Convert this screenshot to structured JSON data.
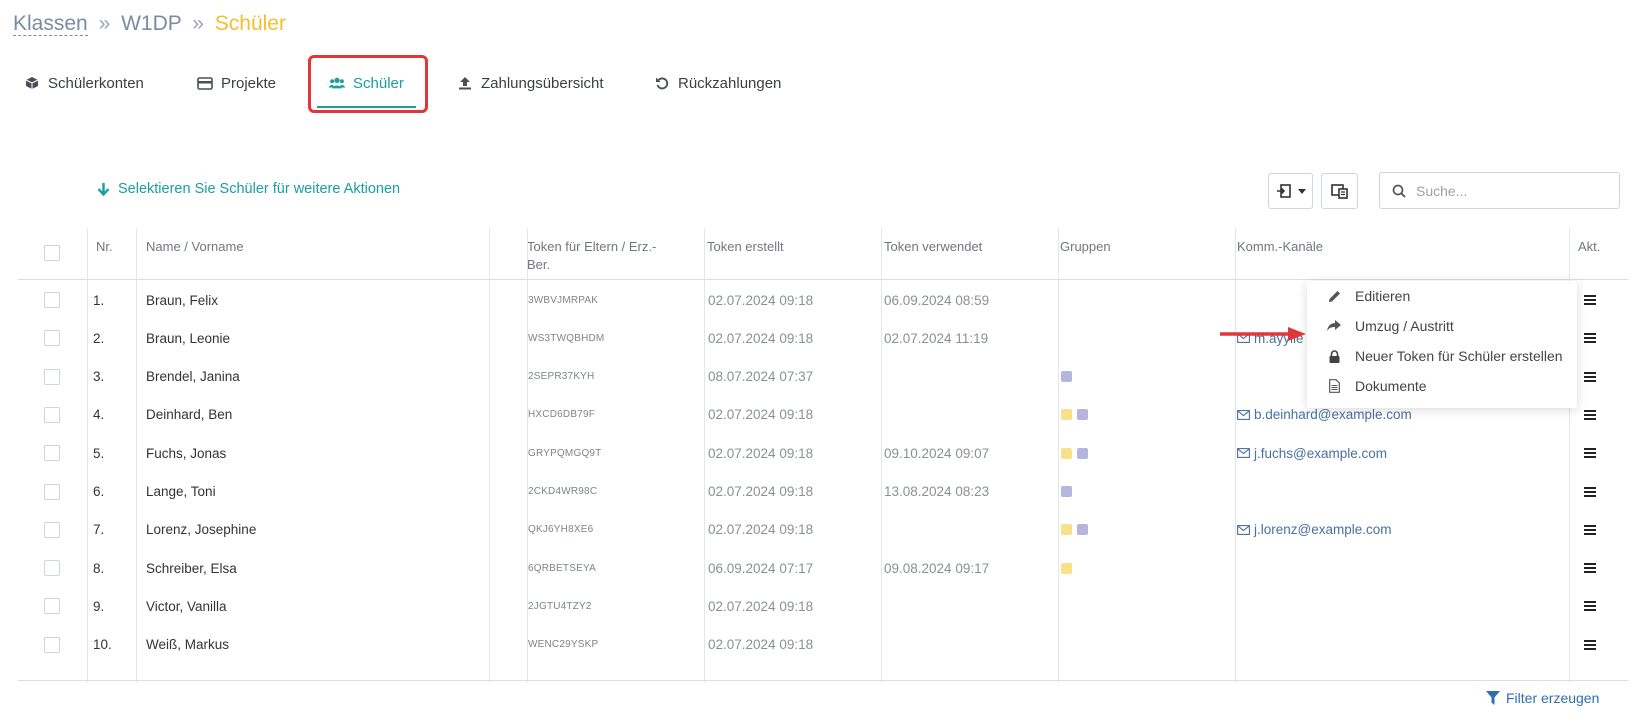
{
  "breadcrumb": {
    "root": "Klassen",
    "sep1": "»",
    "mid": "W1DP",
    "sep2": "»",
    "current": "Schüler"
  },
  "tabs": [
    {
      "label": "Schülerkonten",
      "icon": "cube-icon"
    },
    {
      "label": "Projekte",
      "icon": "card-icon"
    },
    {
      "label": "Schüler",
      "icon": "users-icon",
      "active": true
    },
    {
      "label": "Zahlungsübersicht",
      "icon": "upload-icon"
    },
    {
      "label": "Rückzahlungen",
      "icon": "undo-icon"
    }
  ],
  "select_hint": "Selektieren Sie Schüler für weitere Aktionen",
  "search": {
    "placeholder": "Suche..."
  },
  "table": {
    "headers": {
      "nr": "Nr.",
      "name": "Name / Vorname",
      "token": "Token für Eltern / Erz.-",
      "token2": "Ber.",
      "created": "Token erstellt",
      "used": "Token verwendet",
      "groups": "Gruppen",
      "channels": "Komm.-Kanäle",
      "actions": "Akt."
    },
    "rows": [
      {
        "nr": "1.",
        "name": "Braun, Felix",
        "token": "3WBVJMRPAK",
        "created": "02.07.2024 09:18",
        "used": "06.09.2024 08:59",
        "groups": [],
        "email": ""
      },
      {
        "nr": "2.",
        "name": "Braun, Leonie",
        "token": "WS3TWQBHDM",
        "created": "02.07.2024 09:18",
        "used": "02.07.2024 11:19",
        "groups": [],
        "email": "m.ayylle"
      },
      {
        "nr": "3.",
        "name": "Brendel, Janina",
        "token": "2SEPR37KYH",
        "created": "08.07.2024 07:37",
        "used": "",
        "groups": [
          "#b5b5e0"
        ],
        "email": ""
      },
      {
        "nr": "4.",
        "name": "Deinhard, Ben",
        "token": "HXCD6DB79F",
        "created": "02.07.2024 09:18",
        "used": "",
        "groups": [
          "#f9e08a",
          "#b5b5e0"
        ],
        "email": "b.deinhard@example.com"
      },
      {
        "nr": "5.",
        "name": "Fuchs, Jonas",
        "token": "GRYPQMGQ9T",
        "created": "02.07.2024 09:18",
        "used": "09.10.2024 09:07",
        "groups": [
          "#f9e08a",
          "#b5b5e0"
        ],
        "email": "j.fuchs@example.com"
      },
      {
        "nr": "6.",
        "name": "Lange, Toni",
        "token": "2CKD4WR98C",
        "created": "02.07.2024 09:18",
        "used": "13.08.2024 08:23",
        "groups": [
          "#b5b5e0"
        ],
        "email": ""
      },
      {
        "nr": "7.",
        "name": "Lorenz, Josephine",
        "token": "QKJ6YH8XE6",
        "created": "02.07.2024 09:18",
        "used": "",
        "groups": [
          "#f9e08a",
          "#b5b5e0"
        ],
        "email": "j.lorenz@example.com"
      },
      {
        "nr": "8.",
        "name": "Schreiber, Elsa",
        "token": "6QRBETSEYA",
        "created": "06.09.2024 07:17",
        "used": "09.08.2024 09:17",
        "groups": [
          "#f9e08a"
        ],
        "email": ""
      },
      {
        "nr": "9.",
        "name": "Victor, Vanilla",
        "token": "2JGTU4TZY2",
        "created": "02.07.2024 09:18",
        "used": "",
        "groups": [],
        "email": ""
      },
      {
        "nr": "10.",
        "name": "Weiß, Markus",
        "token": "WENC29YSKP",
        "created": "02.07.2024 09:18",
        "used": "",
        "groups": [],
        "email": ""
      }
    ]
  },
  "dropdown": {
    "items": [
      {
        "label": "Editieren",
        "icon": "pencil-icon"
      },
      {
        "label": "Umzug / Austritt",
        "icon": "share-arrow-icon"
      },
      {
        "label": "Neuer Token für Schüler erstellen",
        "icon": "lock-icon"
      },
      {
        "label": "Dokumente",
        "icon": "document-icon"
      }
    ]
  },
  "footer": {
    "filter_label": "Filter erzeugen"
  },
  "colors": {
    "accent": "#1a9e9e",
    "highlight": "#e0373a",
    "current_crumb": "#f0c030",
    "link": "#2f6fb0"
  }
}
